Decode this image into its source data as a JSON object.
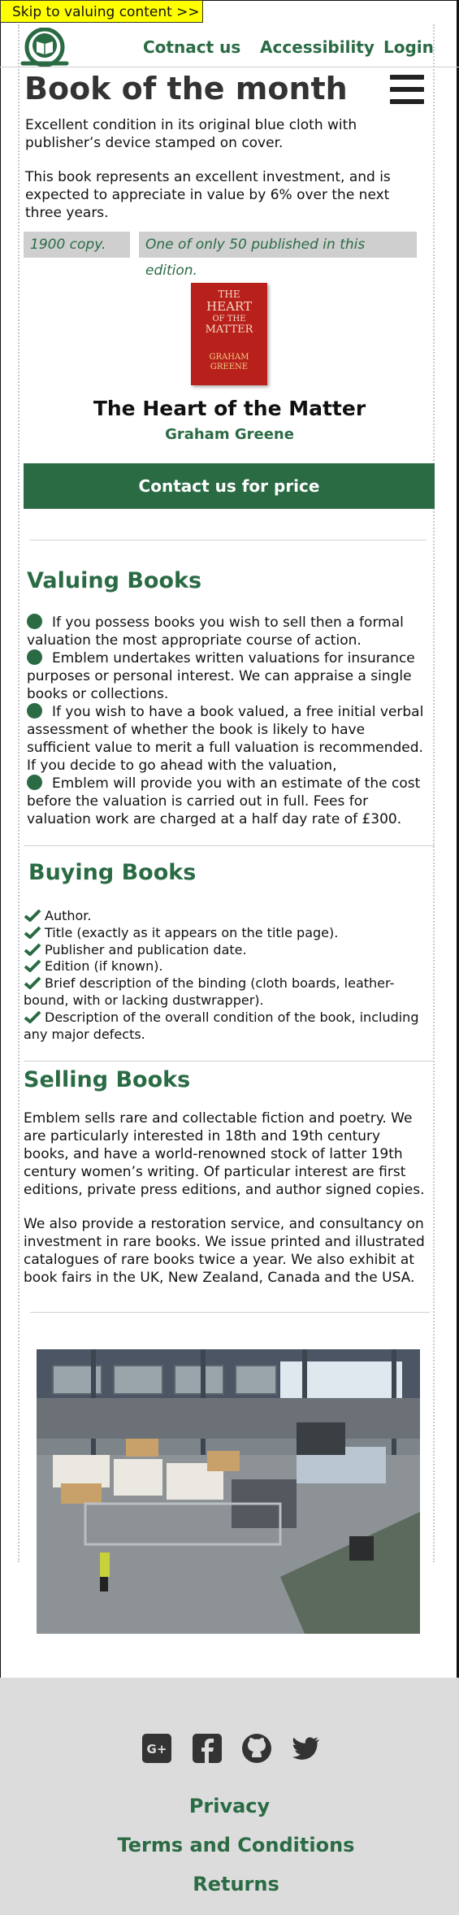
{
  "skip_link": "Skip to valuing content >>",
  "nav": {
    "contact": "Cotnact us",
    "accessibility": "Accessibility",
    "login": "Login"
  },
  "book_of_month": {
    "heading": "Book of the month",
    "para1": "Excellent condition in its original blue cloth with publisher’s device stamped on cover.",
    "para2": "This book represents an excellent investment, and is expected to appreciate in value by 6% over the next three years.",
    "tag_year": "1900 copy.",
    "tag_edition": "One of only 50 published in this edition.",
    "cover": {
      "line1": "THE",
      "line2": "HEART",
      "line3": "OF THE",
      "line4": "MATTER",
      "author": "GRAHAM GREENE"
    },
    "title": "The Heart of the Matter",
    "author": "Graham Greene",
    "cta": "Contact us for price"
  },
  "valuing": {
    "heading": "Valuing Books",
    "items": [
      "If you possess books you wish to sell then a formal valuation the most appropriate course of action.",
      "Emblem undertakes written valuations for insurance purposes or personal interest. We can appraise a single books or collections.",
      "If you wish to have a book valued, a free initial verbal assessment of whether the book is likely to have sufficient value to merit a full valuation is recommended. If you decide to go ahead with the valuation,",
      "Emblem will provide you with an estimate of the cost before the valuation is carried out in full. Fees for valuation work are charged at a half day rate of £300."
    ]
  },
  "buying": {
    "heading": "Buying Books",
    "items": [
      "Author.",
      "Title (exactly as it appears on the title page).",
      "Publisher and publication date.",
      "Edition (if known).",
      "Brief description of the binding (cloth boards, leather-bound, with or lacking dustwrapper).",
      "Description of the overall condition of the book,  including any major defects."
    ]
  },
  "selling": {
    "heading": "Selling Books",
    "para1": "Emblem sells rare and collectable fiction and poetry. We are particularly interested in 18th and 19th century books, and have a world-renowned stock of latter 19th century women’s writing. Of particular interest are first editions, private press editions, and author signed copies.",
    "para2": "We also provide a restoration service, and consultancy on investment in rare books. We issue printed and illustrated catalogues of rare books twice a year. We also exhibit at book fairs in the UK, New Zealand, Canada and the USA."
  },
  "footer": {
    "social": [
      "google-plus-icon",
      "facebook-icon",
      "github-icon",
      "twitter-icon"
    ],
    "links": [
      "Privacy",
      "Terms and Conditions",
      "Returns"
    ]
  },
  "colors": {
    "brand_green": "#2a6b44",
    "tag_grey": "#cfcfcf",
    "footer_grey": "#dcdcdc",
    "skip_yellow": "#ffff00"
  }
}
